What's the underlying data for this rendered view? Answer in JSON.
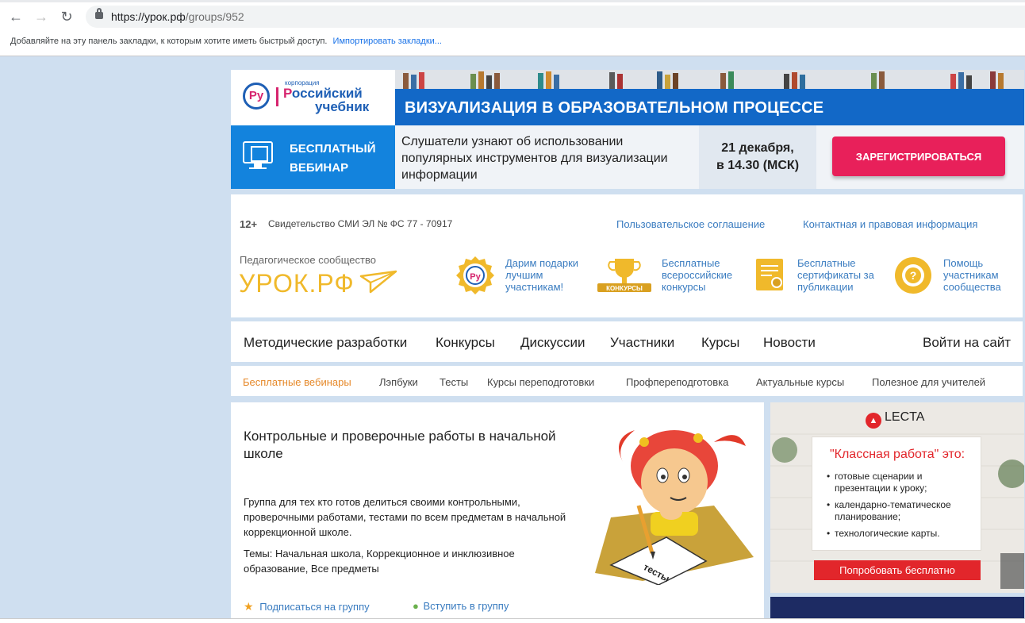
{
  "browser": {
    "url_host": "https://урок.рф",
    "url_path": "/groups/952",
    "bookmarks_hint": "Добавляйте на эту панель закладки, к которым хотите иметь быстрый доступ.",
    "import_bookmarks": "Импортировать закладки..."
  },
  "banner": {
    "logo_small": "корпорация",
    "logo_line1_first": "Р",
    "logo_line1_rest": "оссийский",
    "logo_line2": "учебник",
    "logo_mark": "Ру",
    "title": "ВИЗУАЛИЗАЦИЯ В ОБРАЗОВАТЕЛЬНОМ ПРОЦЕССЕ",
    "free_label_1": "БЕСПЛАТНЫЙ",
    "free_label_2": "ВЕБИНАР",
    "description": "Слушатели узнают об использовании популярных инструментов для визуализации информации",
    "date_line1": "21 декабря,",
    "date_line2": "в 14.30 (МСК)",
    "register_button": "ЗАРЕГИСТРИРОВАТЬСЯ"
  },
  "header": {
    "age": "12+",
    "certificate": "Свидетельство СМИ ЭЛ № ФС 77 - 70917",
    "links": [
      "Пользовательское соглашение",
      "Контактная и правовая информация"
    ],
    "community_label": "Педагогическое сообщество",
    "site_name": "УРОК.РФ",
    "features": [
      {
        "text": "Дарим подарки лучшим участникам!",
        "icon": "gift-badge-icon"
      },
      {
        "text": "Бесплатные всероссийские конкурсы",
        "icon": "trophy-icon",
        "icon_label": "КОНКУРСЫ"
      },
      {
        "text": "Бесплатные сертификаты за публикации",
        "icon": "certificate-icon"
      },
      {
        "text": "Помощь участникам сообщества",
        "icon": "help-icon"
      }
    ]
  },
  "main_nav": {
    "items": [
      "Методические разработки",
      "Конкурсы",
      "Дискуссии",
      "Участники",
      "Курсы",
      "Новости"
    ],
    "login": "Войти на сайт"
  },
  "sub_nav": {
    "items": [
      "Бесплатные вебинары",
      "Лэпбуки",
      "Тесты",
      "Курсы переподготовки",
      "Профпереподготовка",
      "Актуальные курсы",
      "Полезное для учителей"
    ],
    "active_index": 0
  },
  "group": {
    "title": "Контрольные и проверочные работы в начальной школе",
    "description": "Группа для тех кто готов делиться своими контрольными, проверочными работами, тестами по всем предметам в начальной коррекционной школе.",
    "topics": "Темы: Начальная школа, Коррекционное и инклюзивное образование, Все предметы",
    "subscribe": "Подписаться на группу",
    "join": "Вступить в группу",
    "image_text": "тесты"
  },
  "ad": {
    "brand": "LECTA",
    "headline": "\"Классная работа\" это:",
    "items": [
      "готовые сценарии и презентации к уроку;",
      "календарно-тематическое планирование;",
      "технологические карты."
    ],
    "button": "Попробовать бесплатно"
  },
  "colors": {
    "accent_blue": "#1268c7",
    "register_red": "#e8205a",
    "urok_yellow": "#f0b92b",
    "link_blue": "#3a7cc0",
    "active_orange": "#e6892a"
  }
}
